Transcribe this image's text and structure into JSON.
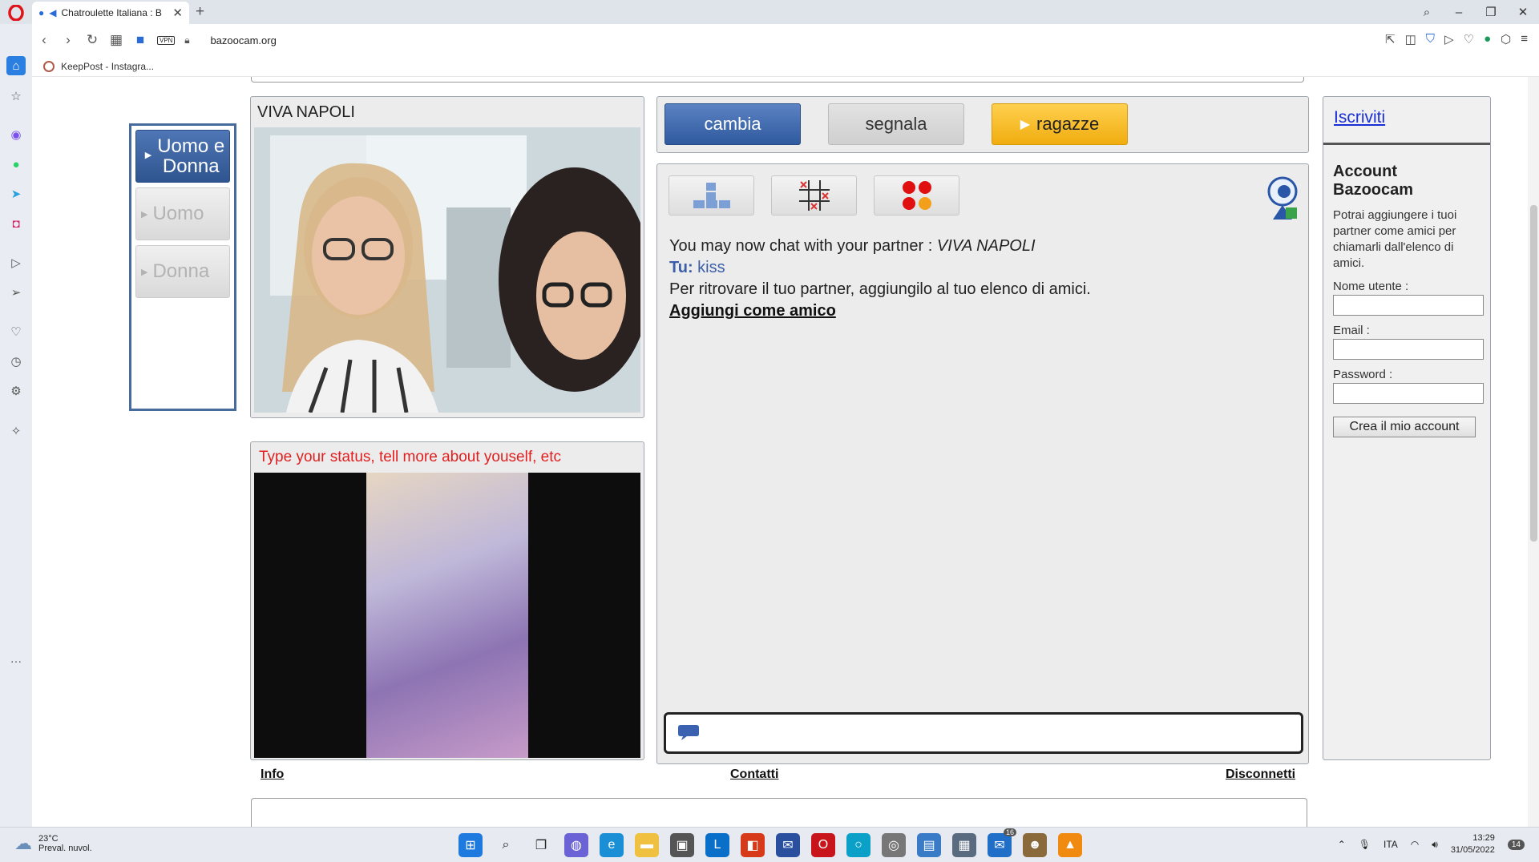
{
  "browser": {
    "tab_title": "Chatroulette Italiana : B",
    "url": "bazoocam.org",
    "vpn_label": "VPN",
    "bookmark": "KeepPost - Instagra..."
  },
  "filter": {
    "items": [
      {
        "label": "Uomo e Donna",
        "active": true
      },
      {
        "label": "Uomo",
        "active": false
      },
      {
        "label": "Donna",
        "active": false
      }
    ]
  },
  "video": {
    "partner_name": "VIVA NAPOLI",
    "status_placeholder": "Type your status, tell more about youself, etc"
  },
  "actions": {
    "cambia": "cambia",
    "segnala": "segnala",
    "ragazze": "ragazze"
  },
  "chat": {
    "intro": "You may now chat with your partner :",
    "partner": "VIVA NAPOLI",
    "me_label": "Tu:",
    "me_message": "kiss",
    "tip": "Per ritrovare il tuo partner, aggiungilo al tuo elenco di amici.",
    "add_friend": "Aggiungi come amico",
    "input_value": ""
  },
  "signup": {
    "link": "Iscriviti",
    "title": "Account Bazoocam",
    "description": "Potrai aggiungere i tuoi partner come amici per chiamarli dall'elenco di amici.",
    "username_label": "Nome utente :",
    "email_label": "Email :",
    "password_label": "Password :",
    "create_button": "Crea il mio account"
  },
  "footer": {
    "info": "Info",
    "contatti": "Contatti",
    "disconnetti": "Disconnetti"
  },
  "taskbar": {
    "temperature": "23°C",
    "weather": "Preval. nuvol.",
    "lang": "ITA",
    "time": "13:29",
    "date": "31/05/2022",
    "notifications": "14",
    "mail_badge": "16"
  },
  "colors": {
    "accent_blue": "#2f5a9e",
    "ragazze_yellow": "#f0ad0f",
    "status_red": "#e02020",
    "link_blue": "#1a2ed6"
  }
}
